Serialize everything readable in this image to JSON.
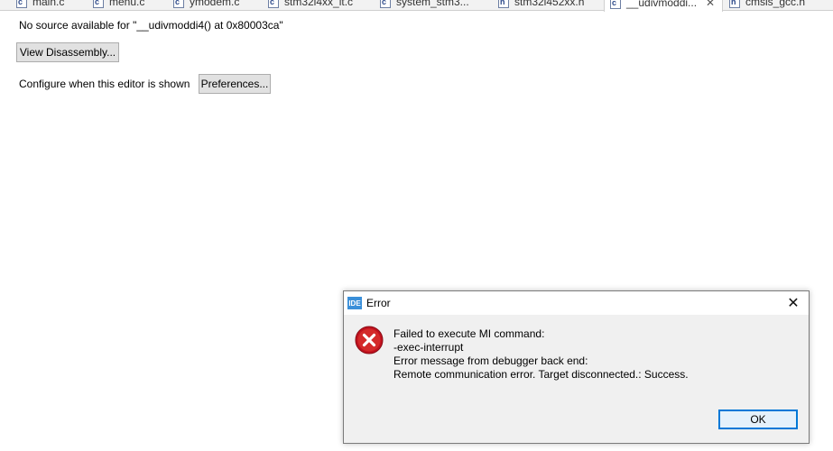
{
  "tabs": [
    {
      "label": "main.c",
      "kind": "c"
    },
    {
      "label": "menu.c",
      "kind": "c"
    },
    {
      "label": "ymodem.c",
      "kind": "c"
    },
    {
      "label": "stm32l4xx_it.c",
      "kind": "c"
    },
    {
      "label": "system_stm3...",
      "kind": "c"
    },
    {
      "label": "stm32l452xx.h",
      "kind": "h"
    },
    {
      "label": "__udivmoddi...",
      "kind": "c",
      "active": true
    },
    {
      "label": "cmsis_gcc.h",
      "kind": "h"
    }
  ],
  "editor": {
    "no_source_text": "No source available for \"__udivmoddi4() at 0x80003ca\"",
    "view_disassembly_label": "View Disassembly...",
    "configure_label": "Configure when this editor is shown",
    "preferences_label": "Preferences..."
  },
  "dialog": {
    "app_icon_text": "IDE",
    "title": "Error",
    "message_lines": [
      "Failed to execute MI command:",
      "-exec-interrupt",
      "Error message from debugger back end:",
      "Remote communication error.  Target disconnected.: Success."
    ],
    "ok_label": "OK",
    "close_glyph": "✕"
  },
  "colors": {
    "error_red": "#d42a2a",
    "ok_border": "#0078d7",
    "ide_blue": "#3a8fd9"
  }
}
